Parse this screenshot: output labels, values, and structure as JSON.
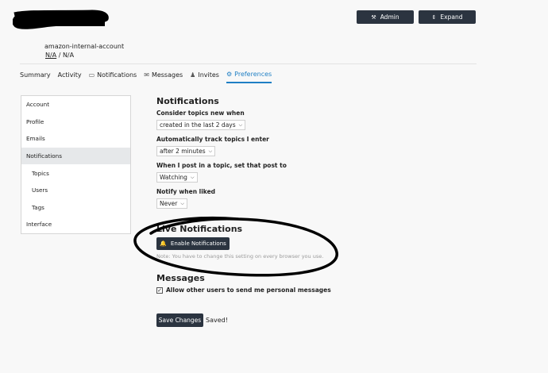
{
  "header": {
    "account_name": "amazon-internal-account",
    "sub_link": "N/A",
    "sub_sep": " / ",
    "sub_text": "N/A",
    "admin_label": "Admin",
    "expand_label": "Expand"
  },
  "nav": {
    "summary": "Summary",
    "activity": "Activity",
    "notifications": "Notifications",
    "messages": "Messages",
    "invites": "Invites",
    "preferences": "Preferences"
  },
  "side_menu": {
    "items": [
      "Account",
      "Profile",
      "Emails",
      "Notifications",
      "Topics",
      "Users",
      "Tags",
      "Interface"
    ],
    "active": "Notifications"
  },
  "notifications": {
    "title": "Notifications",
    "new_topics_label": "Consider topics new when",
    "new_topics_value": "created in the last 2 days",
    "track_label": "Automatically track topics I enter",
    "track_value": "after 2 minutes",
    "post_label": "When I post in a topic, set that post to",
    "post_value": "Watching",
    "liked_label": "Notify when liked",
    "liked_value": "Never"
  },
  "live_notifications": {
    "title": "Live Notifications",
    "button_label": "Enable Notifications",
    "note": "Note: You have to change this setting on every browser you use."
  },
  "messages": {
    "title": "Messages",
    "allow_label": "Allow other users to send me personal messages",
    "allow_checked": true
  },
  "footer": {
    "save_label": "Save Changes",
    "saved_text": "Saved!"
  },
  "colors": {
    "accent": "#1f7fc4",
    "button_bg": "#2b3440",
    "annotation": "#000000"
  }
}
